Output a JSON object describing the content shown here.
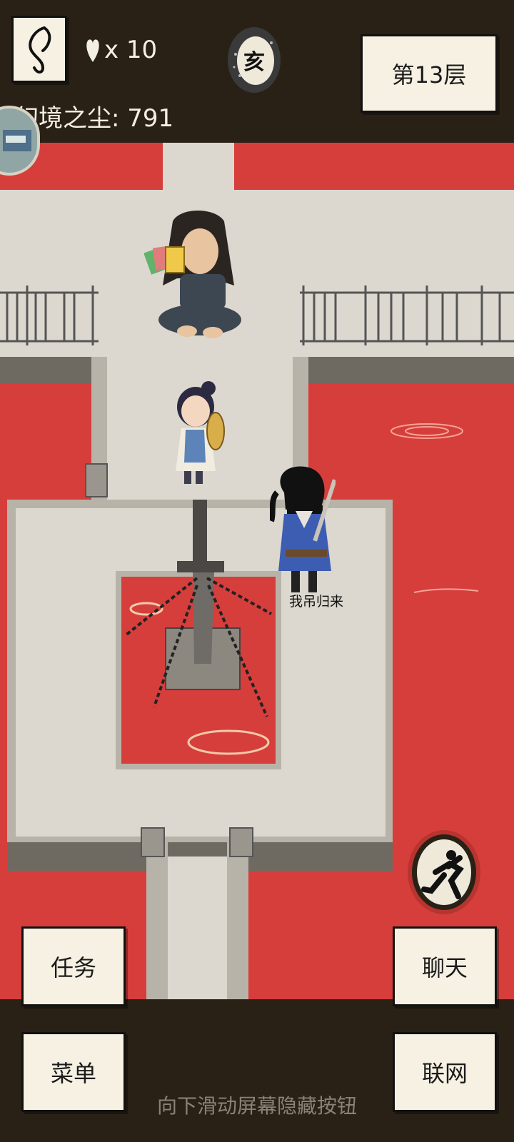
{
  "header": {
    "lives_count": "x 10",
    "dust_text": "幻境之尘: 791",
    "time_glyph": "亥",
    "floor_label": "第13层"
  },
  "scene": {
    "player_name": "我吊归来"
  },
  "buttons": {
    "task": "任务",
    "chat": "聊天",
    "menu": "菜单",
    "network": "联网"
  },
  "footer": {
    "hint": "向下滑动屏幕隐藏按钮"
  },
  "icons": {
    "back": "back-arrow-icon",
    "heart": "heart-icon",
    "run": "running-man-icon"
  },
  "colors": {
    "blood_water": "#d63e3c",
    "stone": "#dcd8cf",
    "bar": "#2a2116",
    "paper": "#f6f1e2"
  }
}
